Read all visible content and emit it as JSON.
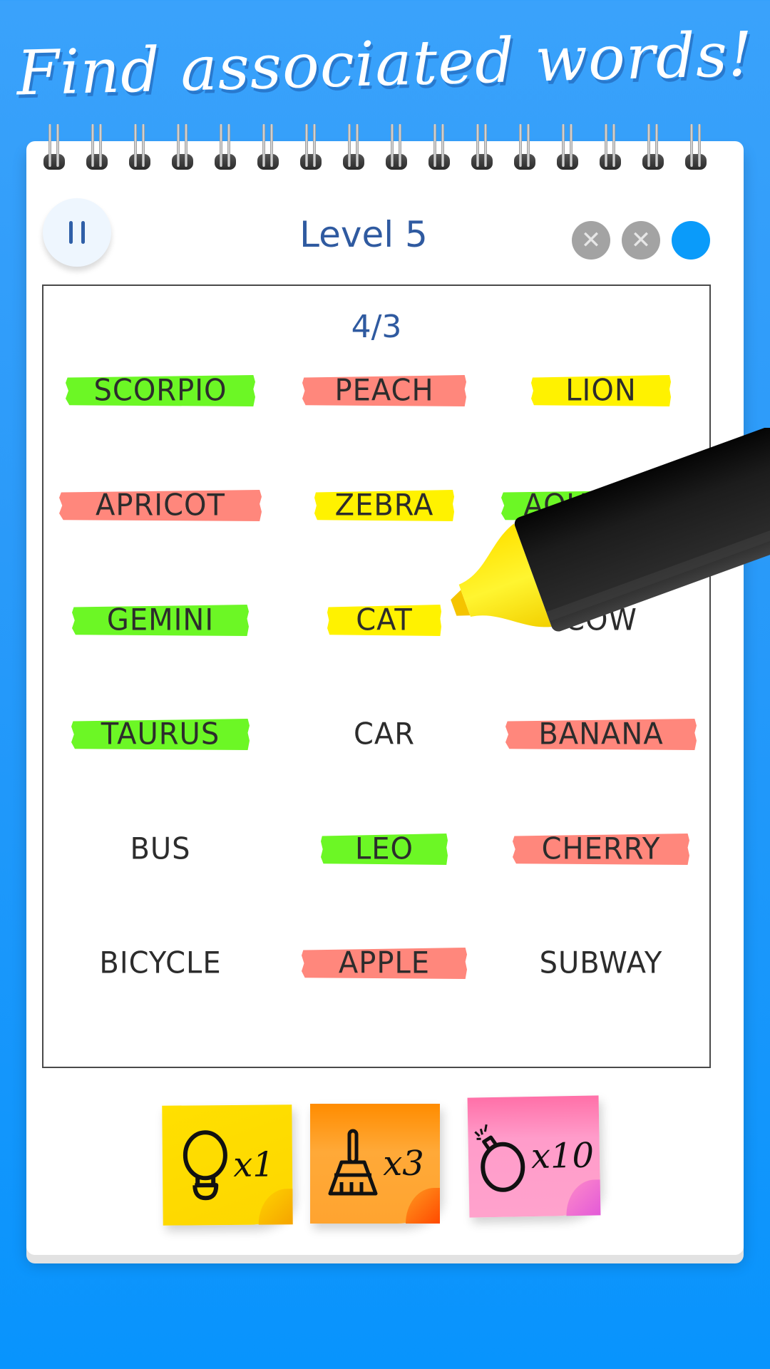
{
  "headline": "Find associated words!",
  "header": {
    "pause_icon": "pause-icon",
    "level_label": "Level 5",
    "lives": [
      {
        "state": "lost",
        "icon": "x-icon",
        "glyph": "✕"
      },
      {
        "state": "lost",
        "icon": "x-icon",
        "glyph": "✕"
      },
      {
        "state": "active",
        "icon": "dot-icon",
        "glyph": ""
      }
    ]
  },
  "board": {
    "progress": "4/3",
    "highlight_colors": {
      "green": "#6cf725",
      "red": "#ff877c",
      "yellow": "#fff200"
    },
    "words": [
      {
        "text": "SCORPIO",
        "highlight": "green"
      },
      {
        "text": "PEACH",
        "highlight": "red"
      },
      {
        "text": "LION",
        "highlight": "yellow"
      },
      {
        "text": "APRICOT",
        "highlight": "red"
      },
      {
        "text": "ZEBRA",
        "highlight": "yellow"
      },
      {
        "text": "AQUARIUS",
        "highlight": "green"
      },
      {
        "text": "GEMINI",
        "highlight": "green"
      },
      {
        "text": "CAT",
        "highlight": "yellow"
      },
      {
        "text": "COW",
        "highlight": null
      },
      {
        "text": "TAURUS",
        "highlight": "green"
      },
      {
        "text": "CAR",
        "highlight": null
      },
      {
        "text": "BANANA",
        "highlight": "red"
      },
      {
        "text": "BUS",
        "highlight": null
      },
      {
        "text": "LEO",
        "highlight": "green"
      },
      {
        "text": "CHERRY",
        "highlight": "red"
      },
      {
        "text": "BICYCLE",
        "highlight": null
      },
      {
        "text": "APPLE",
        "highlight": "red"
      },
      {
        "text": "SUBWAY",
        "highlight": null
      }
    ]
  },
  "boosters": [
    {
      "name": "hint",
      "icon": "lightbulb-icon",
      "count": "x1",
      "color": "#ffdd00"
    },
    {
      "name": "broom",
      "icon": "broom-icon",
      "count": "x3",
      "color": "#ffa030"
    },
    {
      "name": "bomb",
      "icon": "bomb-icon",
      "count": "x10",
      "color": "#ff9ccb"
    }
  ],
  "marker": {
    "icon": "highlighter-marker-icon",
    "tip_color": "#ffe81a",
    "body_color": "#1e1e1e"
  }
}
